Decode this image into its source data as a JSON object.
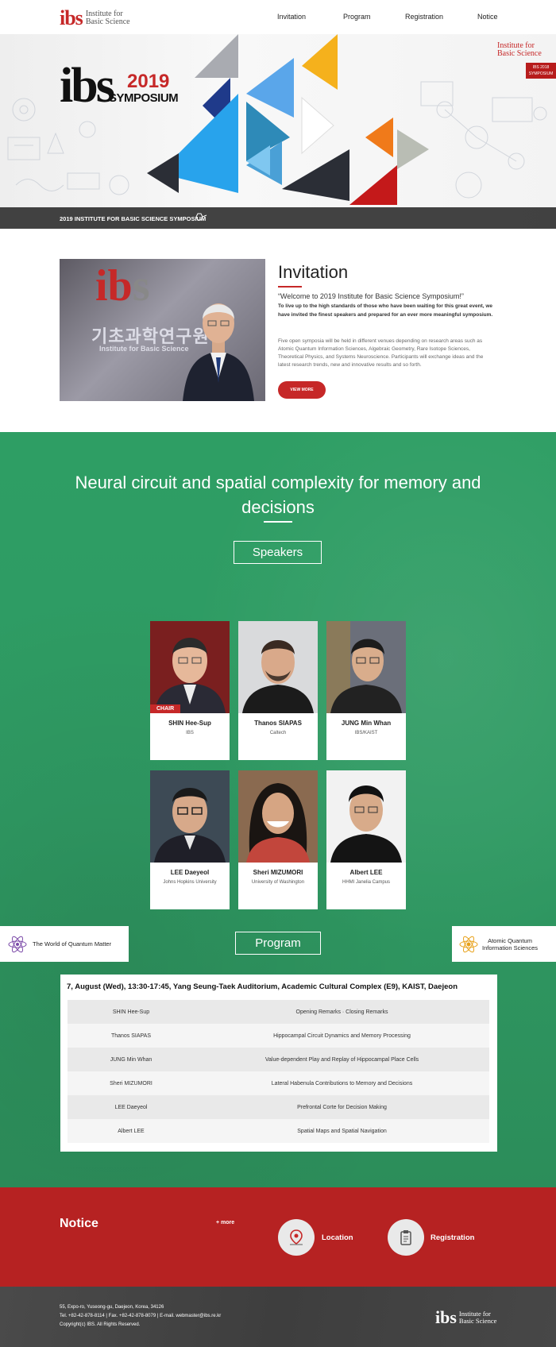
{
  "header": {
    "logo_mark": "ibs",
    "logo_line1": "Institute for",
    "logo_line2": "Basic Science",
    "nav": [
      "Invitation",
      "Program",
      "Registration",
      "Notice"
    ]
  },
  "hero": {
    "ibs": "ibs",
    "year": "2019",
    "symposium": "SYMPOSIUM",
    "badge_line1": "Institute for",
    "badge_line2": "Basic Science",
    "badge_red1": "IBS 2018",
    "badge_red2": "SYMPOSIUM",
    "strip_text": "2019 INSTITUTE FOR BASIC SCIENCE SYMPOSIUM"
  },
  "invitation": {
    "title": "Invitation",
    "quote": "“Welcome to 2019 Institute for Basic Science Symposium!”",
    "lead": "To live up to the high standards of those who have been waiting for this great event, we have invited the finest speakers and prepared for an ever more meaningful symposium.",
    "body": "Five open symposia will be held in different venues depending on research areas such as Atomic Quantum Information Sciences, Algebraic Geometry, Rare Isotope Sciences, Theoretical Physics, and Systems Neuroscience. Participants will exchange ideas and the latest research trends, new and innovative results and so forth.",
    "button": "VIEW MORE",
    "sign_ko": "기초과학연구원",
    "sign_en": "Institute for Basic Science"
  },
  "session": {
    "title": "Neural circuit and spatial complexity for memory and decisions",
    "speakers_label": "Speakers",
    "program_label": "Program",
    "left_tab": "The World of Quantum Matter",
    "right_tab_line1": "Atomic Quantum",
    "right_tab_line2": "Information Sciences",
    "chair_label": "CHAIR",
    "speakers": [
      {
        "name": "SHIN Hee-Sup",
        "aff": "IBS"
      },
      {
        "name": "Thanos SIAPAS",
        "aff": "Caltech"
      },
      {
        "name": "JUNG Min Whan",
        "aff": "IBS/KAIST"
      },
      {
        "name": "LEE Daeyeol",
        "aff": "Johns Hopkins University"
      },
      {
        "name": "Sheri MIZUMORI",
        "aff": "University of Washington"
      },
      {
        "name": "Albert LEE",
        "aff": "HHMI Janelia Campus"
      }
    ],
    "program_head": "7, August (Wed), 13:30-17:45, Yang Seung-Taek Auditorium, Academic Cultural Complex (E9), KAIST, Daejeon",
    "program": [
      {
        "speaker": "SHIN Hee-Sup",
        "talk": "Opening Remarks · Closing Remarks"
      },
      {
        "speaker": "Thanos SIAPAS",
        "talk": "Hippocampal Circuit Dynamics and Memory Processing"
      },
      {
        "speaker": "JUNG Min Whan",
        "talk": "Value-dependent Play and Replay of Hippocampal Place Cells"
      },
      {
        "speaker": "Sheri MIZUMORI",
        "talk": "Lateral Habenula Contributions to Memory and Decisions"
      },
      {
        "speaker": "LEE Daeyeol",
        "talk": "Prefrontal Corte for Decision Making"
      },
      {
        "speaker": "Albert LEE",
        "talk": "Spatial Maps and Spatial Navigation"
      }
    ]
  },
  "notice": {
    "title": "Notice",
    "more": "+ more",
    "location": "Location",
    "registration": "Registration"
  },
  "footer": {
    "address": "55, Expo-ro, Yuseong-gu, Daejeon, Korea, 34126",
    "contact": "Tel. +82-42-878-8114 | Fax. +82-42-878-8079 | E-mail. webmaster@ibs.re.kr",
    "copyright": "Copyright(c) IBS. All Rights Reserved.",
    "logo_mark": "ibs",
    "logo_line1": "Institute for",
    "logo_line2": "Basic Science"
  }
}
